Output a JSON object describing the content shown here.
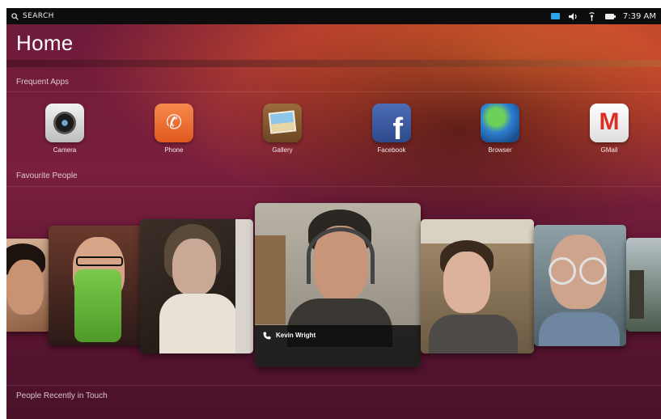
{
  "status_bar": {
    "search_label": "SEARCH",
    "time": "7:39 AM"
  },
  "page": {
    "title": "Home"
  },
  "sections": {
    "frequent_apps": "Frequent Apps",
    "favourite_people": "Favourite People",
    "recently_in_touch": "People Recently in Touch"
  },
  "apps": [
    {
      "label": "Camera",
      "icon": "camera-icon"
    },
    {
      "label": "Phone",
      "icon": "phone-icon"
    },
    {
      "label": "Gallery",
      "icon": "gallery-icon"
    },
    {
      "label": "Facebook",
      "icon": "facebook-icon"
    },
    {
      "label": "Browser",
      "icon": "browser-icon"
    },
    {
      "label": "GMail",
      "icon": "gmail-icon"
    }
  ],
  "featured_contact": {
    "name": "Kevin Wright",
    "icon": "phone-icon"
  },
  "colors": {
    "accent_orange": "#e6662d",
    "background_aubergine": "#6d1a3a",
    "panel": "#0d0d0d",
    "mail_indicator": "#2aa3ea"
  }
}
